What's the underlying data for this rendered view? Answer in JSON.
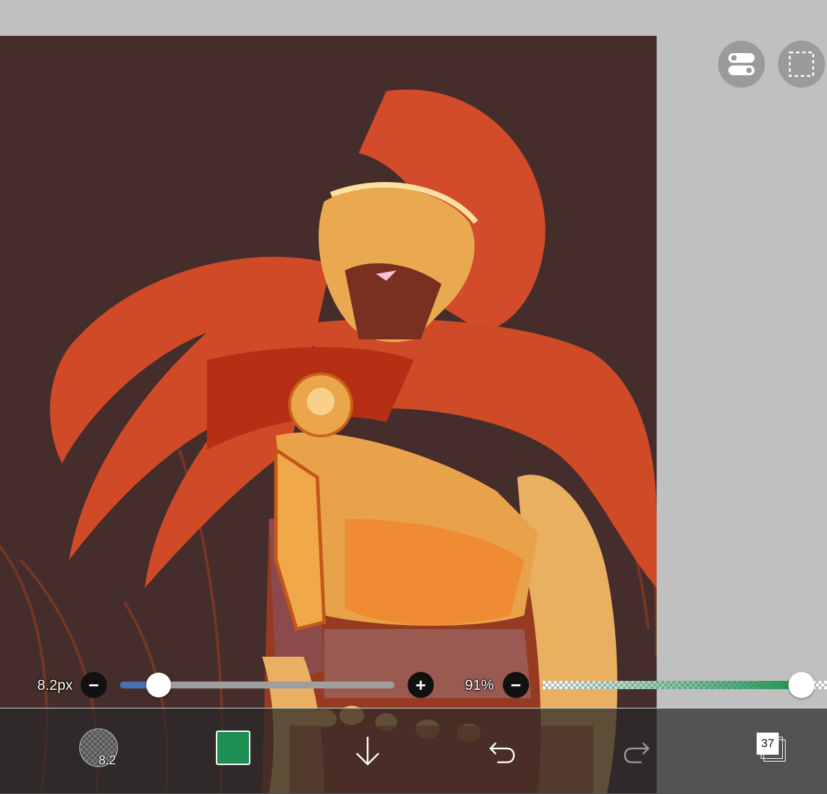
{
  "controls": {
    "brush_size_label": "8.2px",
    "brush_size_fraction": 0.14,
    "opacity_label": "91%",
    "opacity_fraction": 0.91,
    "minus_glyph": "−",
    "plus_glyph": "+"
  },
  "toolbar": {
    "brush_size_text": "8.2",
    "current_color": "#1e8f52",
    "layer_count": "37"
  },
  "icons": {
    "top_right": [
      "toggle-icon",
      "selection-icon"
    ],
    "toolbar": [
      "brush-icon",
      "color-swatch",
      "download-icon",
      "undo-icon",
      "redo-icon",
      "layers-icon"
    ]
  },
  "colors": {
    "canvas_background": "#452d2b",
    "slider_fill": "#4a6fb5",
    "opacity_fill": "#1e9254"
  }
}
